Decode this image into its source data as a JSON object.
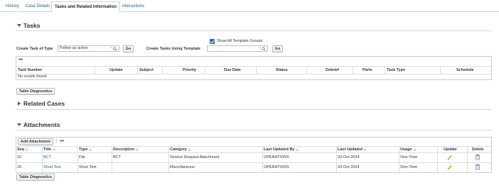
{
  "tabs": [
    "History",
    "Case Details",
    "Tasks and Related Information",
    "Interactions"
  ],
  "tasks": {
    "title": "Tasks",
    "show_all_label": "Show All Template Groups",
    "show_all_checked": true,
    "create_type_label": "Create Task of Type",
    "create_type_value": "Follow up action",
    "go_label": "Go",
    "create_template_label": "Create Tasks Using Template",
    "create_template_value": "",
    "columns": [
      "Task Number",
      "Update",
      "Subject",
      "Priority",
      "Due Date",
      "Status",
      "Debrief",
      "Parts",
      "Task Type",
      "Schedule"
    ],
    "empty_text": "No results found.",
    "diagnostics_label": "Table Diagnostics"
  },
  "related_cases": {
    "title": "Related Cases"
  },
  "attachments": {
    "title": "Attachments",
    "add_label": "Add Attachment",
    "columns": [
      "Seq",
      "Title",
      "Type",
      "Description",
      "Category",
      "Last Updated By",
      "Last Updated",
      "Usage",
      "Update",
      "Delete"
    ],
    "rows": [
      {
        "seq": "10",
        "title": "BCT",
        "type": "File",
        "description": "BCT",
        "category": "Service Request Attachment",
        "updated_by": "OPERATIONS",
        "updated": "03-Oct-2024",
        "usage": "One-Time"
      },
      {
        "seq": "20",
        "title": "Short Text",
        "type": "Short Text",
        "description": "",
        "category": "Miscellaneous",
        "updated_by": "OPERATIONS",
        "updated": "03-Oct-2024",
        "usage": "One-Time"
      }
    ],
    "diagnostics_label": "Table Diagnostics"
  },
  "icons": {
    "edit": "pencil-icon",
    "delete": "trash-icon",
    "search": "search-icon"
  }
}
